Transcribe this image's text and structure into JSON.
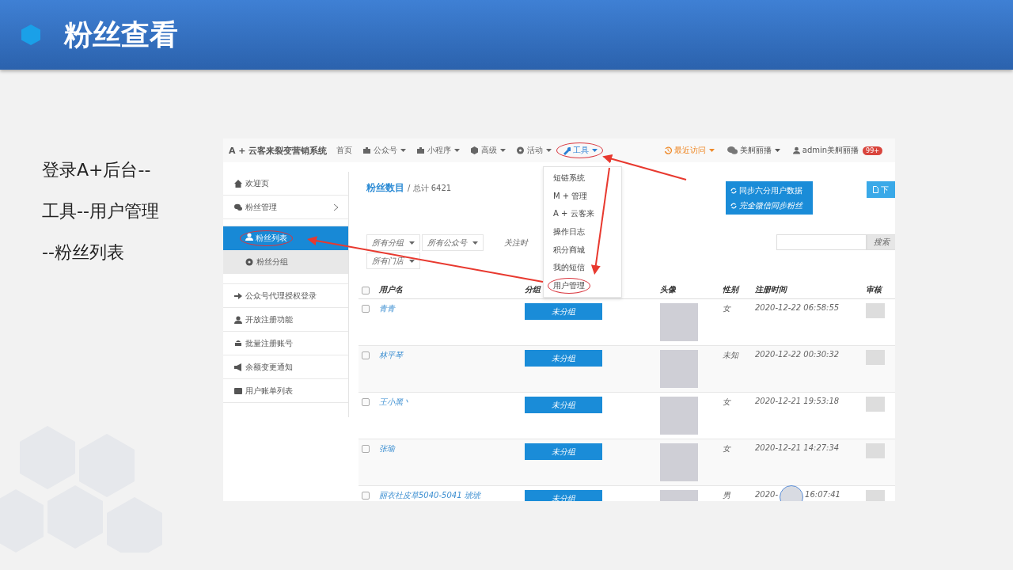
{
  "slide": {
    "title": "粉丝查看",
    "steps": [
      "登录A+后台--",
      "工具--用户管理",
      "--粉丝列表"
    ]
  },
  "app": {
    "brand": "A + 云客来裂变营销系统",
    "nav": [
      {
        "label": "首页",
        "dropdown": false,
        "selected": false,
        "circled": false
      },
      {
        "label": "公众号",
        "dropdown": true,
        "selected": false,
        "circled": false
      },
      {
        "label": "小程序",
        "dropdown": true,
        "selected": false,
        "circled": false
      },
      {
        "label": "高级",
        "dropdown": true,
        "selected": false,
        "circled": false
      },
      {
        "label": "活动",
        "dropdown": true,
        "selected": false,
        "circled": false
      },
      {
        "label": "工具",
        "dropdown": true,
        "selected": true,
        "circled": true
      }
    ],
    "nav_right": [
      {
        "kind": "recent",
        "label": "最近访问"
      },
      {
        "kind": "account",
        "label": "美舸丽播"
      },
      {
        "kind": "user",
        "label": "admin美舸丽播",
        "badge": "99+"
      }
    ],
    "tools_menu": [
      {
        "label": "短链系统",
        "circled": false
      },
      {
        "label": "M + 管理",
        "circled": false
      },
      {
        "label": "A + 云客来",
        "circled": false
      },
      {
        "label": "操作日志",
        "circled": false
      },
      {
        "label": "积分商城",
        "circled": false
      },
      {
        "label": "我的短信",
        "circled": false
      },
      {
        "label": "用户管理",
        "circled": true
      }
    ],
    "sidebar": [
      {
        "label": "欢迎页",
        "selected": false
      },
      {
        "label": "粉丝管理",
        "selected": false,
        "expanded": true,
        "children": [
          {
            "label": "粉丝列表",
            "selected": true,
            "circled": true
          },
          {
            "label": "粉丝分组",
            "selected": false
          }
        ]
      },
      {
        "label": "公众号代理授权登录",
        "selected": false
      },
      {
        "label": "开放注册功能",
        "selected": false
      },
      {
        "label": "批量注册账号",
        "selected": false
      },
      {
        "label": "余额变更通知",
        "selected": false
      },
      {
        "label": "用户账单列表",
        "selected": false
      }
    ],
    "page_title": "粉丝数目",
    "total": "/ 总计 6421",
    "sync_buttons": [
      "同步六分用户数据",
      "完全微信同步粉丝"
    ],
    "download_button": "下",
    "filters": [
      {
        "label": "所有分组"
      },
      {
        "label": "所有公众号"
      },
      {
        "label": "所有门店"
      }
    ],
    "follow_time_label": "关注时",
    "search_button": "搜索",
    "table": {
      "header_checked": false,
      "columns": [
        "用户名",
        "分组",
        "头像",
        "性别",
        "注册时间",
        "审核"
      ],
      "rows": [
        {
          "checked": false,
          "name": "青青",
          "group": "未分组",
          "gender": "女",
          "reg_time": "2020-12-22 06:58:55"
        },
        {
          "checked": false,
          "name": "林平琴",
          "group": "未分组",
          "gender": "未知",
          "reg_time": "2020-12-22 00:30:32"
        },
        {
          "checked": false,
          "name": "王小黑丶",
          "group": "未分组",
          "gender": "女",
          "reg_time": "2020-12-21 19:53:18"
        },
        {
          "checked": false,
          "name": "张瑜",
          "group": "未分组",
          "gender": "女",
          "reg_time": "2020-12-21 14:27:34"
        },
        {
          "checked": false,
          "name": "丽衣社皮草5040-5041 琥琥",
          "group": "未分组",
          "gender": "男",
          "reg_time": "2020-",
          "reg_time_after": "16:07:41"
        }
      ]
    }
  }
}
